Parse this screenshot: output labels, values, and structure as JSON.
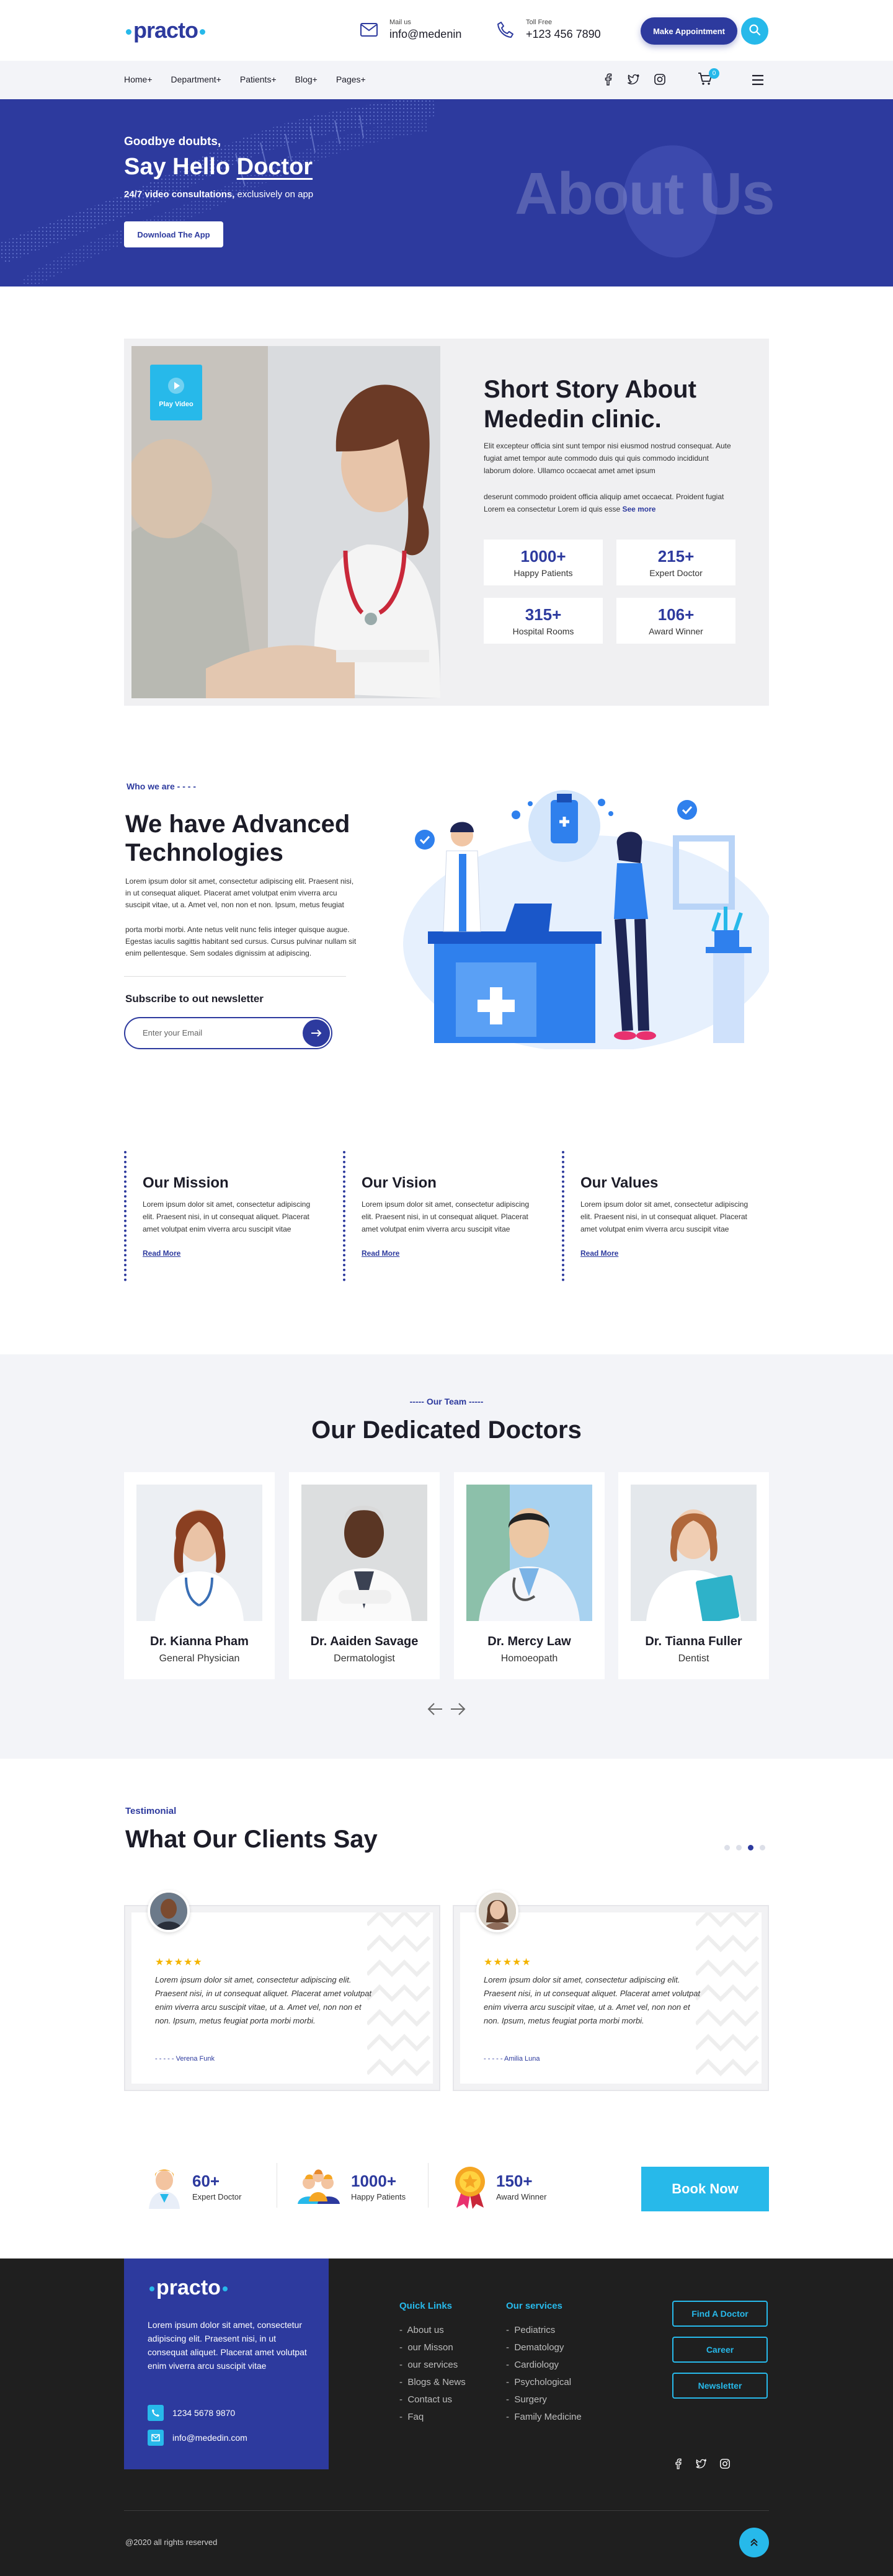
{
  "brand": {
    "name": "practo",
    "accent": "#27b9ea",
    "primary": "#2d3a9e"
  },
  "header": {
    "mail_label": "Mail us",
    "mail_value": "info@medenin",
    "phone_label": "Toll Free",
    "phone_value": "+123 456 7890",
    "appointment_button": "Make Appointment",
    "nav": [
      "Home+",
      "Department+",
      "Patients+",
      "Blog+",
      "Pages+"
    ],
    "cart_count": "0"
  },
  "hero": {
    "kicker": "Goodbye doubts,",
    "title_pre": "Say Hello ",
    "title_em": "Doctor",
    "tag_bold": "24/7 video consultations,",
    "tag_rest": " exclusively on app",
    "button": "Download The App",
    "watermark": "About Us"
  },
  "story": {
    "play_label": "Play Video",
    "title": "Short Story About Mededin clinic.",
    "p1": "Elit excepteur officia sint sunt tempor nisi eiusmod nostrud consequat. Aute fugiat amet tempor aute commodo duis qui quis commodo incididunt laborum dolore. Ullamco occaecat amet amet ipsum",
    "p2": "deserunt commodo proident officia aliquip amet occaecat. Proident fugiat Lorem ea consectetur Lorem id quis esse ",
    "see_more": "See more",
    "stats": [
      {
        "n": "1000+",
        "l": "Happy Patients"
      },
      {
        "n": "215+",
        "l": "Expert Doctor"
      },
      {
        "n": "315+",
        "l": "Hospital Rooms"
      },
      {
        "n": "106+",
        "l": "Award Winner"
      }
    ]
  },
  "about": {
    "kicker": "Who we are - - - -",
    "title": "We have Advanced Technologies",
    "p1": "Lorem ipsum dolor sit amet, consectetur adipiscing elit. Praesent nisi, in ut consequat aliquet. Placerat amet volutpat enim viverra arcu suscipit vitae, ut a. Amet vel, non non et non. Ipsum, metus feugiat",
    "p2": "porta morbi morbi. Ante netus velit nunc felis integer quisque augue. Egestas iaculis sagittis habitant sed cursus. Cursus pulvinar nullam sit enim pellentesque. Sem sodales dignissim at adipiscing.",
    "newsletter_title": "Subscribe to out newsletter",
    "email_placeholder": "Enter your Email"
  },
  "values": [
    {
      "title": "Our Mission",
      "text": "Lorem ipsum dolor sit amet, consectetur adipiscing elit. Praesent nisi, in ut consequat aliquet. Placerat amet volutpat enim viverra arcu suscipit vitae",
      "link": "Read More"
    },
    {
      "title": "Our Vision",
      "text": "Lorem ipsum dolor sit amet, consectetur adipiscing elit. Praesent nisi, in ut consequat aliquet. Placerat amet volutpat enim viverra arcu suscipit vitae",
      "link": "Read More"
    },
    {
      "title": "Our Values",
      "text": "Lorem ipsum dolor sit amet, consectetur adipiscing elit. Praesent nisi, in ut consequat aliquet. Placerat amet volutpat enim viverra arcu suscipit vitae",
      "link": "Read More"
    }
  ],
  "team": {
    "kicker": "----- Our Team -----",
    "title": "Our Dedicated Doctors",
    "doctors": [
      {
        "name": "Dr. Kianna Pham",
        "role": "General Physician"
      },
      {
        "name": "Dr. Aaiden Savage",
        "role": "Dermatologist"
      },
      {
        "name": "Dr. Mercy Law",
        "role": "Homoeopath"
      },
      {
        "name": "Dr. Tianna Fuller",
        "role": "Dentist"
      }
    ]
  },
  "testimonial": {
    "kicker": "Testimonial",
    "title": "What Our Clients Say",
    "reviews": [
      {
        "stars": "★★★★★",
        "text": "Lorem ipsum dolor sit amet, consectetur adipiscing elit. Praesent nisi, in ut consequat aliquet. Placerat amet volutpat enim viverra arcu suscipit vitae, ut a. Amet vel, non non et non. Ipsum, metus feugiat porta morbi morbi.",
        "author": "- - - - -  Verena Funk"
      },
      {
        "stars": "★★★★★",
        "text": "Lorem ipsum dolor sit amet, consectetur adipiscing elit. Praesent nisi, in ut consequat aliquet. Placerat amet volutpat enim viverra arcu suscipit vitae, ut a. Amet vel, non non et non. Ipsum, metus feugiat porta morbi morbi.",
        "author": "- - - - -  Amilia Luna"
      }
    ]
  },
  "band": {
    "stats": [
      {
        "n": "60+",
        "l": "Expert Doctor"
      },
      {
        "n": "1000+",
        "l": "Happy Patients"
      },
      {
        "n": "150+",
        "l": "Award Winner"
      }
    ],
    "book": "Book Now"
  },
  "footer": {
    "about": "Lorem ipsum dolor sit amet, consectetur adipiscing elit. Praesent nisi, in ut consequat aliquet. Placerat amet volutpat enim viverra arcu suscipit vitae",
    "phone": "1234 5678 9870",
    "email": "info@mededin.com",
    "quick_title": "Quick Links",
    "quick": [
      "About us",
      "our Misson",
      "our services",
      "Blogs & News",
      "Contact us",
      "Faq"
    ],
    "services_title": "Our services",
    "services": [
      "Pediatrics",
      "Dematology",
      "Cardiology",
      "Psychological",
      "Surgery",
      "Family Medicine"
    ],
    "buttons": [
      "Find A Doctor",
      "Career",
      "Newsletter"
    ],
    "copyright": "@2020 all rights reserved"
  }
}
